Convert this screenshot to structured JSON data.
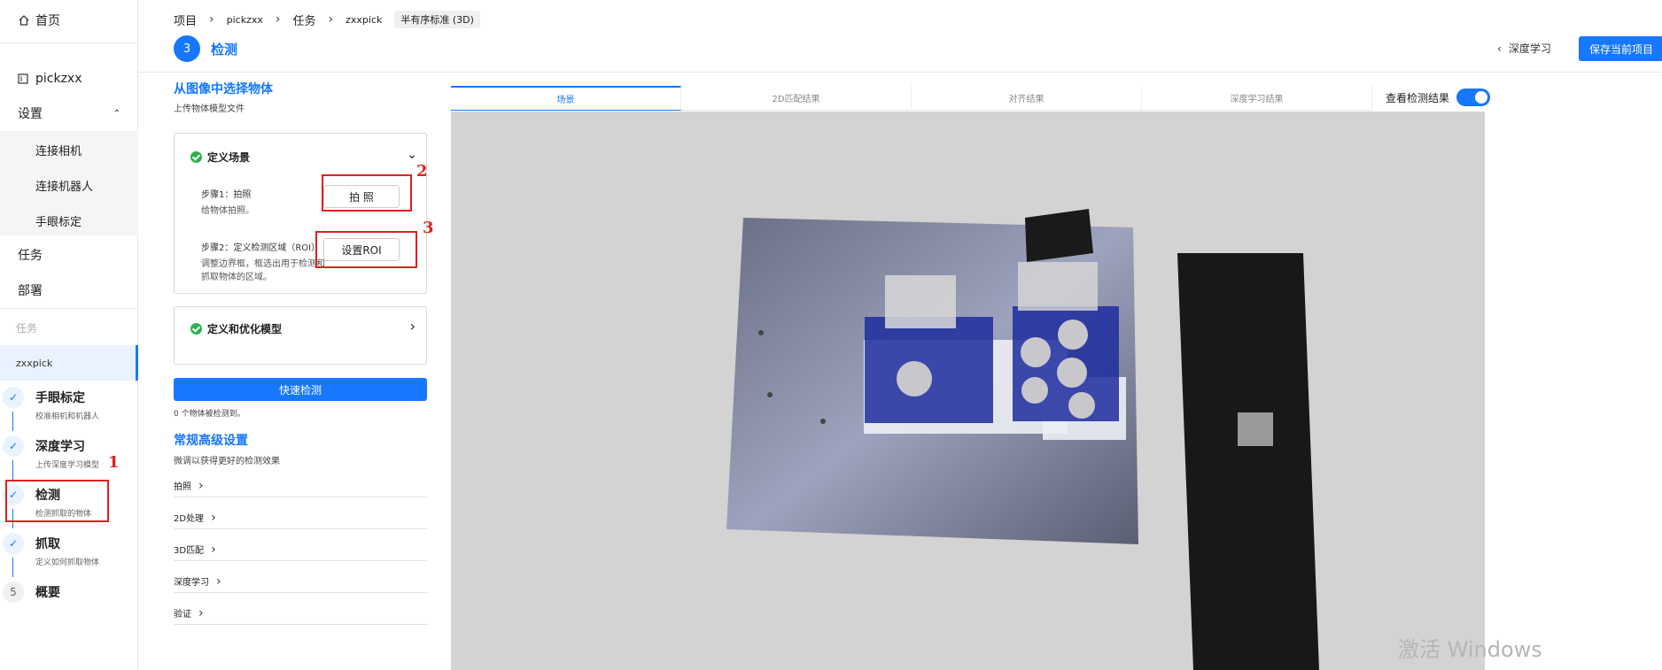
{
  "sidebar": {
    "home": "首页",
    "project": "pickzxx",
    "settings": "设置",
    "settings_children": [
      "连接相机",
      "连接机器人",
      "手眼标定"
    ],
    "task": "任务",
    "deploy": "部署",
    "task_header": "任务",
    "task_current": "zxxpick",
    "steps": [
      {
        "num": "",
        "title": "手眼标定",
        "desc": "校准相机和机器人",
        "done": true
      },
      {
        "num": "",
        "title": "深度学习",
        "desc": "上传深度学习模型",
        "done": true
      },
      {
        "num": "",
        "title": "检测",
        "desc": "检测抓取的物体",
        "done": true
      },
      {
        "num": "",
        "title": "抓取",
        "desc": "定义如何抓取物体",
        "done": true
      },
      {
        "num": "5",
        "title": "概要",
        "desc": "",
        "done": false
      }
    ]
  },
  "breadcrumb": [
    "项目",
    "pickzxx",
    "任务",
    "zxxpick"
  ],
  "breadcrumb_tag": "半有序标准 (3D)",
  "page": {
    "step_number": "3",
    "title": "检测"
  },
  "header": {
    "back_label": "深度学习",
    "save_label": "保存当前项目"
  },
  "left": {
    "section_title": "从图像中选择物体",
    "section_sub": "上传物体模型文件",
    "card1": {
      "title": "定义场景",
      "step1_label": "步骤1：拍照",
      "step1_desc": "给物体拍照。",
      "step1_button": "拍 照",
      "step2_label": "步骤2：定义检测区域（ROI）",
      "step2_desc": "调整边界框，框选出用于检测和抓取物体的区域。",
      "step2_button": "设置ROI"
    },
    "card2": {
      "title": "定义和优化模型"
    },
    "quick_detect": "快速检测",
    "detect_count": "0 个物体被检测到。",
    "advanced_title": "常规高级设置",
    "advanced_sub": "微调以获得更好的检测效果",
    "advanced_items": [
      "拍照",
      "2D处理",
      "3D匹配",
      "深度学习",
      "验证"
    ]
  },
  "tabs": [
    "场景",
    "2D匹配结果",
    "对齐结果",
    "深度学习结果"
  ],
  "view_toggle_label": "查看检测结果",
  "annotations": [
    "1",
    "2",
    "3"
  ],
  "watermark": "激活 Windows",
  "colors": {
    "accent": "#1677ff",
    "annotation": "#e02020",
    "success": "#2bb24c"
  }
}
